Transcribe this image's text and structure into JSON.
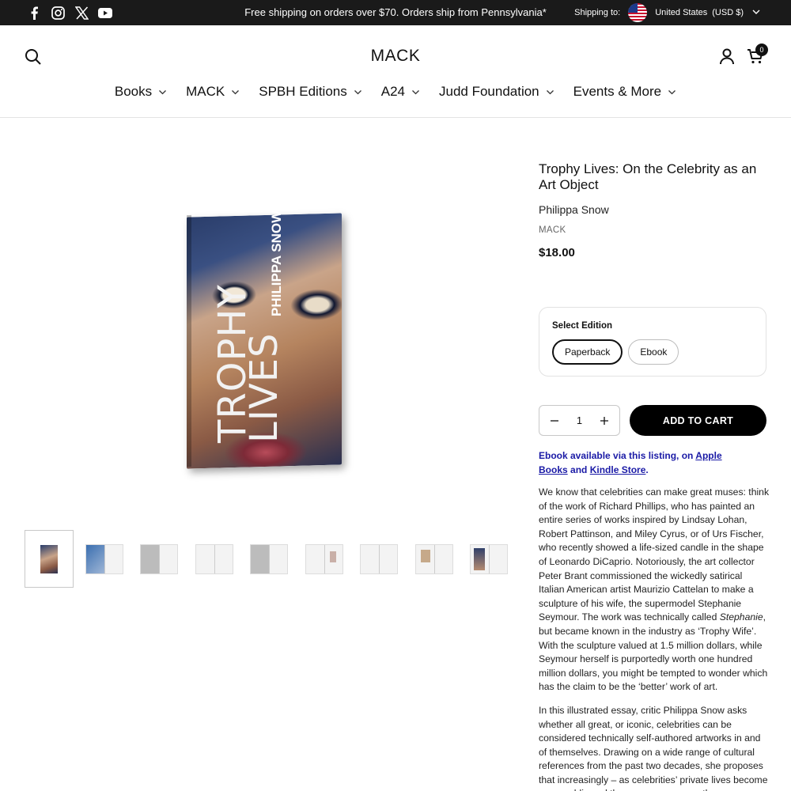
{
  "topbar": {
    "social_icons": [
      "facebook-icon",
      "instagram-icon",
      "x-icon",
      "youtube-icon"
    ],
    "announcement": "Free shipping on orders over $70. Orders ship from Pennsylvania*",
    "shipping_label": "Shipping to:",
    "country": "United States",
    "currency": "(USD $)"
  },
  "header": {
    "logo": "MACK",
    "cart_count": "0",
    "nav": [
      "Books",
      "MACK",
      "SPBH Editions",
      "A24",
      "Judd Foundation",
      "Events & More"
    ]
  },
  "gallery": {
    "cover_title_line1": "TROPHY",
    "cover_title_line2": "LIVES",
    "cover_author": "PHILIPPA SNOW",
    "thumbnail_count": 9
  },
  "product": {
    "title": "Trophy Lives: On the Celebrity as an Art Object",
    "author": "Philippa Snow",
    "publisher": "MACK",
    "price": "$18.00",
    "edition_label": "Select Edition",
    "editions": [
      "Paperback",
      "Ebook"
    ],
    "selected_edition": "Paperback",
    "quantity": "1",
    "add_to_cart": "ADD TO CART",
    "ebook_note": {
      "prefix": "Ebook available via this listing, on ",
      "link1": "Apple Books",
      "middle": " and ",
      "link2": "Kindle Store",
      "suffix": "."
    },
    "description_p1_a": "We know that celebrities can make great muses: think of the work of Richard Phillips, who has painted an entire series of works inspired by Lindsay Lohan, Robert Pattinson, and Miley Cyrus, or of Urs Fischer, who recently showed a life-sized candle in the shape of Leonardo DiCaprio. Notoriously, the art collector Peter Brant commissioned the wickedly satirical Italian American artist Maurizio Cattelan to make a sculpture of his wife, the supermodel Stephanie Seymour. The work was technically called ",
    "description_p1_em": "Stephanie",
    "description_p1_b": ", but became known in the industry as ‘Trophy Wife’. With the sculpture valued at 1.5 million dollars, while Seymour herself is purportedly worth one hundred million dollars, you might be tempted to wonder which has the claim to be the ‘better’ work of art.",
    "description_p2": "In this illustrated essay, critic Philippa Snow asks whether all great, or iconic, celebrities can be considered technically self-authored artworks in and of themselves. Drawing on a wide range of cultural references from the past two decades, she proposes that increasingly – as celebrities’ private lives become more public and the way we consume them ever more voyeuristic"
  }
}
